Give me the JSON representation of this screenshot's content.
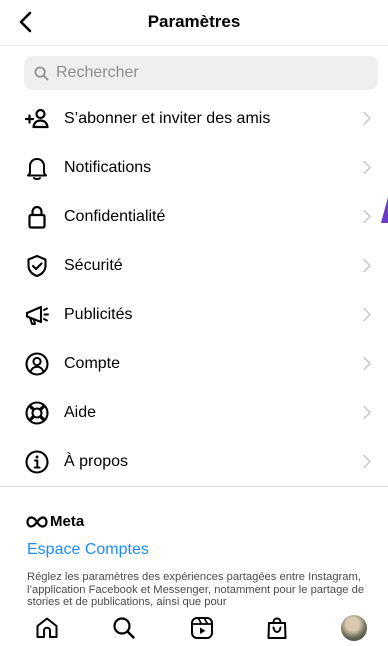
{
  "header": {
    "title": "Paramètres",
    "back_icon": "chevron-left-icon"
  },
  "search": {
    "placeholder": "Rechercher",
    "value": ""
  },
  "menu_items": [
    {
      "label": "S’abonner et inviter des amis",
      "icon": "add-person-icon"
    },
    {
      "label": "Notifications",
      "icon": "bell-icon"
    },
    {
      "label": "Confidentialité",
      "icon": "lock-icon"
    },
    {
      "label": "Sécurité",
      "icon": "shield-check-icon"
    },
    {
      "label": "Publicités",
      "icon": "megaphone-icon"
    },
    {
      "label": "Compte",
      "icon": "account-circle-icon"
    },
    {
      "label": "Aide",
      "icon": "lifebuoy-icon"
    },
    {
      "label": "À propos",
      "icon": "info-icon"
    }
  ],
  "meta": {
    "brand": "Meta",
    "accounts_link": "Espace Comptes",
    "description": "Réglez les paramètres des expériences partagées entre Instagram, l’application Facebook et Messenger, notamment pour le partage de stories et de publications, ainsi que pour"
  },
  "bottom_nav": [
    "home-icon",
    "search-icon",
    "reels-icon",
    "shop-icon",
    "profile-avatar"
  ],
  "colors": {
    "link": "#1a8cff",
    "accent": "#6a3cc8",
    "chevron": "#c7c7c7",
    "search_bg": "#efefef"
  }
}
